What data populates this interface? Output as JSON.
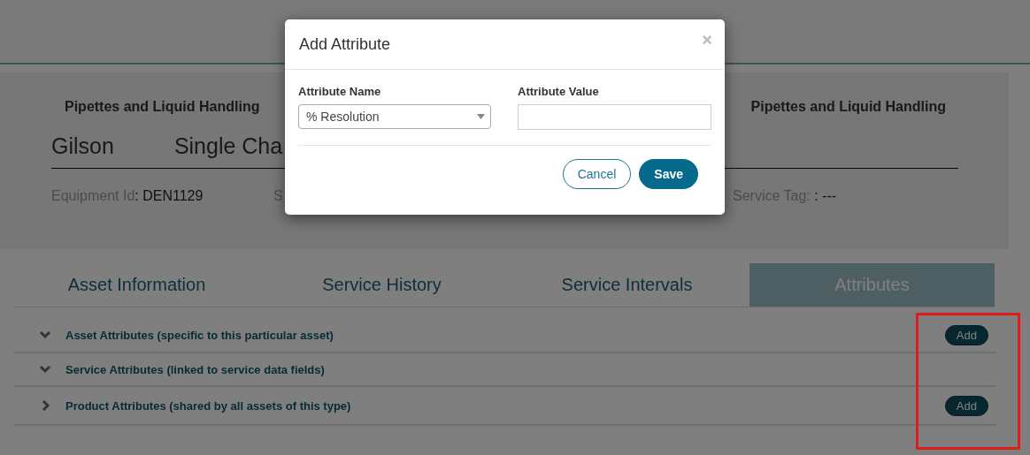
{
  "asset": {
    "category_left": "Pipettes and Liquid Handling",
    "category_right": "Pipettes and Liquid Handling",
    "manufacturer": "Gilson",
    "model": "Single Cha",
    "fields": [
      {
        "label": "Equipment Id",
        "value": ": DEN1129"
      },
      {
        "label": "S"
      }
    ],
    "service_tag": {
      "label": "Service Tag:",
      "value": ": ---"
    }
  },
  "tabs": [
    {
      "label": "Asset Information",
      "selected": false
    },
    {
      "label": "Service History",
      "selected": false
    },
    {
      "label": "Service Intervals",
      "selected": false
    },
    {
      "label": "Attributes",
      "selected": true
    }
  ],
  "sections": [
    {
      "title": "Asset Attributes (specific to this particular asset)",
      "expanded": true,
      "button": "Add"
    },
    {
      "title": "Service Attributes (linked to service data fields)",
      "expanded": true
    },
    {
      "title": "Product Attributes (shared by all assets of this type)",
      "expanded": false,
      "button": "Add"
    }
  ],
  "dialog": {
    "title": "Add Attribute",
    "close": "×",
    "name_label": "Attribute Name",
    "name_value": "% Resolution",
    "value_label": "Attribute Value",
    "buttons": [
      {
        "label": "Cancel",
        "kind": "secondary"
      },
      {
        "label": "Save",
        "kind": "primary"
      }
    ]
  }
}
